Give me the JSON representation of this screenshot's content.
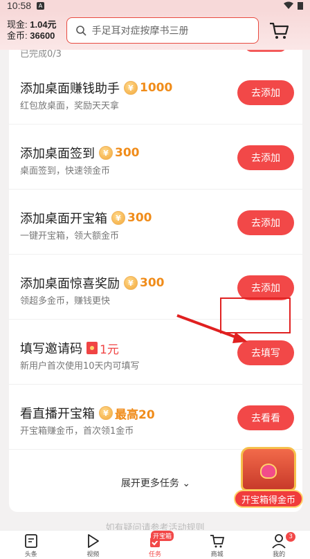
{
  "status_bar": {
    "time": "10:58",
    "badge": "A"
  },
  "header": {
    "cash_label": "现金:",
    "cash_value": "1.04元",
    "coins_label": "金币:",
    "coins_value": "36600",
    "search_placeholder": "手足耳对症按摩书三册"
  },
  "tasks": [
    {
      "title": "添加桌面赚钱助手",
      "reward": "1000",
      "subtitle": "红包放桌面，奖励天天拿",
      "action": "去添加",
      "icon": "coin-icon"
    },
    {
      "title": "添加桌面签到",
      "reward": "300",
      "subtitle": "桌面签到，快速领金币",
      "action": "去添加",
      "icon": "coin-icon"
    },
    {
      "title": "添加桌面开宝箱",
      "reward": "300",
      "subtitle": "一键开宝箱，领大额金币",
      "action": "去添加",
      "icon": "coin-icon"
    },
    {
      "title": "添加桌面惊喜奖励",
      "reward": "300",
      "subtitle": "领超多金币，赚钱更快",
      "action": "去添加",
      "icon": "coin-icon"
    },
    {
      "title": "填写邀请码",
      "reward": "1元",
      "subtitle": "新用户首次使用10天内可填写",
      "action": "去填写",
      "icon": "red-packet-icon"
    },
    {
      "title": "看直播开宝箱",
      "reward": "最高20",
      "subtitle": "开宝箱赚金币，首次领1金币",
      "action": "去看看",
      "icon": "coin-icon"
    }
  ],
  "coin_symbol": "¥",
  "peek_text": "已完成0/3",
  "more_tasks": "展开更多任务",
  "treasure_label": "开宝箱得金币",
  "footnote": "如有疑问请参考活动规则",
  "nav": [
    {
      "label": "头条",
      "icon": "news-icon"
    },
    {
      "label": "视频",
      "icon": "play-icon"
    },
    {
      "label": "任务",
      "icon": "task-icon",
      "tag": "开宝箱"
    },
    {
      "label": "商城",
      "icon": "cart-icon"
    },
    {
      "label": "我的",
      "icon": "profile-icon",
      "badge": "3"
    }
  ],
  "colors": {
    "accent": "#f24848",
    "coin": "#f08c1a"
  }
}
